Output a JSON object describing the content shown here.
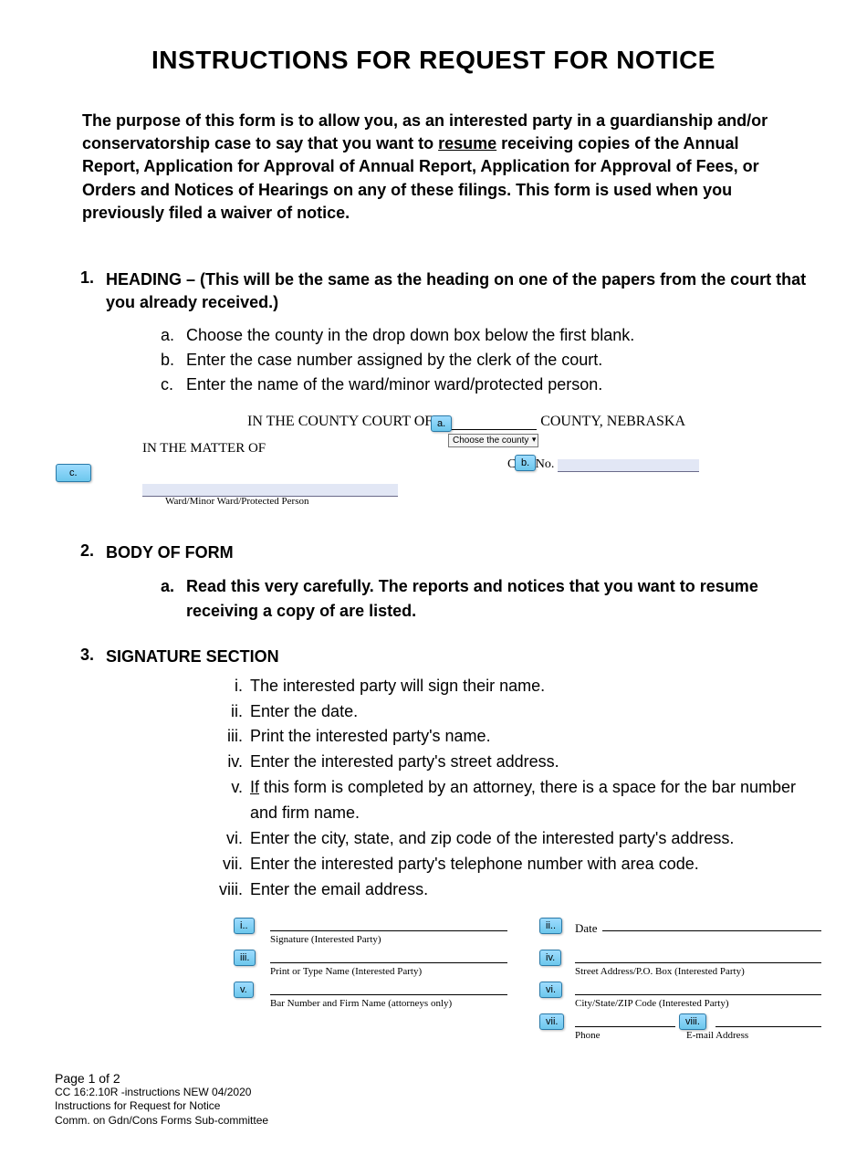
{
  "title": "INSTRUCTIONS FOR REQUEST FOR NOTICE",
  "purpose_pre": "The purpose of this form is to allow you, as an interested party in a guardianship and/or conservatorship case to say that you want to ",
  "purpose_underline": "resume",
  "purpose_post": " receiving copies of the Annual Report, Application for Approval of Annual Report, Application for Approval of Fees, or Orders and Notices of Hearings on any of these filings.  This form is used when you previously filed a waiver of notice.",
  "s1": {
    "title": "HEADING – (This will be the same as the heading on one of the papers from the court that you already received.)",
    "a": "Choose the county in the drop down box below the first blank.",
    "b": "Enter the case number assigned by the clerk of the court.",
    "c": "Enter the name of the ward/minor ward/protected person."
  },
  "heading_example": {
    "court_pre": "IN THE  COUNTY  COURT  OF ",
    "court_post": " COUNTY, NEBRASKA",
    "matter": "IN THE MATTER OF",
    "dropdown": "Choose the county",
    "case_no_label": "Case No.",
    "ward_caption": "Ward/Minor Ward/Protected Person",
    "cal_a": "a.",
    "cal_b": "b.",
    "cal_c": "c."
  },
  "s2": {
    "title": "BODY OF FORM",
    "a": "Read this very carefully.  The reports and notices that you want to resume receiving a copy of are listed."
  },
  "s3": {
    "title": "SIGNATURE SECTION",
    "i": "The interested party will sign their name.",
    "ii": "Enter the date.",
    "iii": "Print the interested party's name.",
    "iv": "Enter the interested party's street address.",
    "v_pre": "If",
    "v_post": " this form is completed by an attorney, there is a space for the bar number and firm name.",
    "vi": "Enter the city, state, and zip code of the interested party's address.",
    "vii": "Enter the interested party's telephone number with area code.",
    "viii": "Enter the email address."
  },
  "sig_example": {
    "cal_i": "i..",
    "cal_ii": "ii..",
    "cal_iii": "iii.",
    "cal_iv": "iv.",
    "cal_v": "v.",
    "cal_vi": "vi.",
    "cal_vii": "vii.",
    "cal_viii": "viii.",
    "date": "Date",
    "sig_cap": "Signature (Interested Party)",
    "print_cap": "Print or Type Name (Interested Party)",
    "bar_cap": "Bar Number and Firm Name (attorneys only)",
    "street_cap": "Street Address/P.O. Box (Interested Party)",
    "city_cap": "City/State/ZIP Code (Interested Party)",
    "phone_cap": "Phone",
    "email_cap": "E-mail Address"
  },
  "footer": {
    "page": "Page 1 of 2",
    "code": "CC 16:2.10R -instructions NEW 04/2020",
    "name": "Instructions for Request for Notice",
    "comm": "Comm. on Gdn/Cons Forms Sub-committee"
  }
}
